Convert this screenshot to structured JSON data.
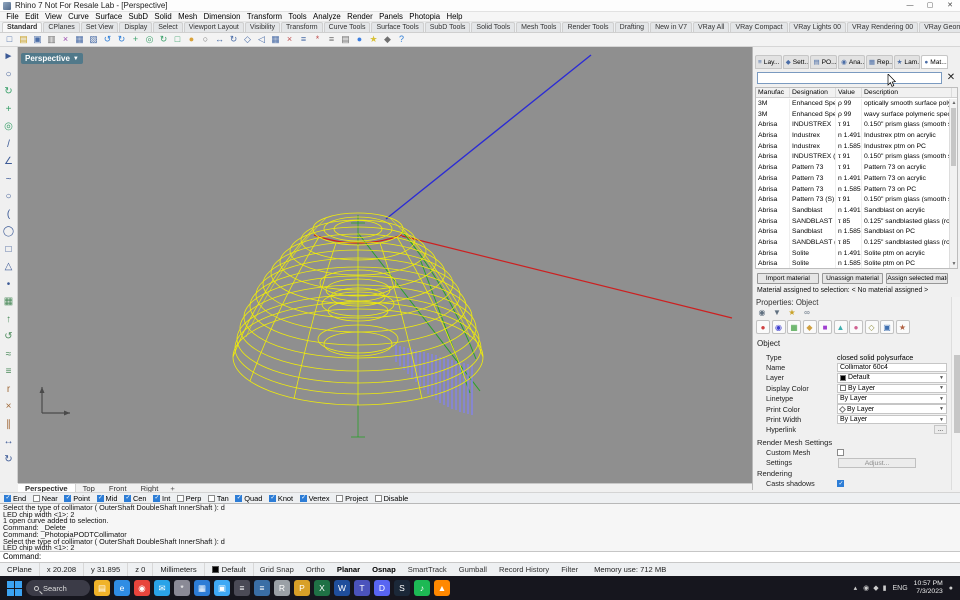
{
  "window": {
    "title": "Rhino 7 Not For Resale Lab - [Perspective]",
    "minimize": "—",
    "maximize": "▢",
    "close": "✕"
  },
  "menu": [
    "File",
    "Edit",
    "View",
    "Curve",
    "Surface",
    "SubD",
    "Solid",
    "Mesh",
    "Dimension",
    "Transform",
    "Tools",
    "Analyze",
    "Render",
    "Panels",
    "Photopia",
    "Help"
  ],
  "toolbar_tabs": [
    "Standard",
    "CPlanes",
    "Set View",
    "Display",
    "Select",
    "Viewport Layout",
    "Visibility",
    "Transform",
    "Curve Tools",
    "Surface Tools",
    "SubD Tools",
    "Solid Tools",
    "Mesh Tools",
    "Render Tools",
    "Drafting",
    "New in V7",
    "VRay All",
    "VRay Compact",
    "VRay Lights 00",
    "VRay Rendering 00",
    "VRay Geometry"
  ],
  "toolbar_icons": [
    {
      "name": "new-file-icon",
      "glyph": "□",
      "color": "#4a6da7"
    },
    {
      "name": "open-file-icon",
      "glyph": "▤",
      "color": "#c9a227"
    },
    {
      "name": "save-icon",
      "glyph": "▣",
      "color": "#4a6da7"
    },
    {
      "name": "print-icon",
      "glyph": "▥",
      "color": "#707070"
    },
    {
      "name": "cut-icon",
      "glyph": "×",
      "color": "#9a4aae"
    },
    {
      "name": "copy-icon",
      "glyph": "▦",
      "color": "#4a6da7"
    },
    {
      "name": "paste-icon",
      "glyph": "▧",
      "color": "#4a6da7"
    },
    {
      "name": "undo-icon",
      "glyph": "↺",
      "color": "#2d7dd6"
    },
    {
      "name": "redo-icon",
      "glyph": "↻",
      "color": "#2d7dd6"
    },
    {
      "name": "pan-view-icon",
      "glyph": "+",
      "color": "#3aa06a"
    },
    {
      "name": "zoom-icon",
      "glyph": "◎",
      "color": "#3aa06a"
    },
    {
      "name": "rotate-view-icon",
      "glyph": "↻",
      "color": "#3aa06a"
    },
    {
      "name": "zoom-extents-icon",
      "glyph": "□",
      "color": "#3aa06a"
    },
    {
      "name": "shaded-view-icon",
      "glyph": "●",
      "color": "#d9a23a"
    },
    {
      "name": "wireframe-view-icon",
      "glyph": "○",
      "color": "#707070"
    },
    {
      "name": "move-icon",
      "glyph": "↔",
      "color": "#4a6da7"
    },
    {
      "name": "rotate-icon",
      "glyph": "↻",
      "color": "#4a6da7"
    },
    {
      "name": "scale-icon",
      "glyph": "◇",
      "color": "#4a6da7"
    },
    {
      "name": "mirror-icon",
      "glyph": "◁",
      "color": "#4a6da7"
    },
    {
      "name": "array-icon",
      "glyph": "▦",
      "color": "#4a6da7"
    },
    {
      "name": "trim-icon",
      "glyph": "×",
      "color": "#c05050"
    },
    {
      "name": "join-icon",
      "glyph": "≡",
      "color": "#4a6da7"
    },
    {
      "name": "explode-icon",
      "glyph": "*",
      "color": "#c05050"
    },
    {
      "name": "layers-icon",
      "glyph": "≡",
      "color": "#707070"
    },
    {
      "name": "properties-icon",
      "glyph": "▤",
      "color": "#707070"
    },
    {
      "name": "render-icon",
      "glyph": "●",
      "color": "#3a7de0"
    },
    {
      "name": "lights-icon",
      "glyph": "★",
      "color": "#d9c23a"
    },
    {
      "name": "options-icon",
      "glyph": "◆",
      "color": "#707070"
    },
    {
      "name": "help-icon",
      "glyph": "?",
      "color": "#2d7dd6"
    }
  ],
  "left_toolbar": [
    {
      "name": "select-pointer-icon",
      "glyph": "►",
      "color": "#3c5a96"
    },
    {
      "name": "lasso-select-icon",
      "glyph": "○",
      "color": "#3c5a96"
    },
    {
      "name": "view-rotate-icon",
      "glyph": "↻",
      "color": "#3aa06a"
    },
    {
      "name": "pan-icon",
      "glyph": "+",
      "color": "#3aa06a"
    },
    {
      "name": "zoom-window-icon",
      "glyph": "◎",
      "color": "#3aa06a"
    },
    {
      "name": "line-tool-icon",
      "glyph": "/",
      "color": "#3c5a96"
    },
    {
      "name": "polyline-tool-icon",
      "glyph": "∠",
      "color": "#3c5a96"
    },
    {
      "name": "curve-tool-icon",
      "glyph": "~",
      "color": "#3c5a96"
    },
    {
      "name": "circle-tool-icon",
      "glyph": "○",
      "color": "#3c5a96"
    },
    {
      "name": "arc-tool-icon",
      "glyph": "(",
      "color": "#3c5a96"
    },
    {
      "name": "ellipse-tool-icon",
      "glyph": "◯",
      "color": "#3c5a96"
    },
    {
      "name": "rectangle-tool-icon",
      "glyph": "□",
      "color": "#3c5a96"
    },
    {
      "name": "polygon-tool-icon",
      "glyph": "△",
      "color": "#3c5a96"
    },
    {
      "name": "point-tool-icon",
      "glyph": "•",
      "color": "#3c5a96"
    },
    {
      "name": "surface-tool-icon",
      "glyph": "▦",
      "color": "#4a8a5a"
    },
    {
      "name": "extrude-tool-icon",
      "glyph": "↑",
      "color": "#4a8a5a"
    },
    {
      "name": "revolve-tool-icon",
      "glyph": "↺",
      "color": "#4a8a5a"
    },
    {
      "name": "sweep-tool-icon",
      "glyph": "≈",
      "color": "#4a8a5a"
    },
    {
      "name": "loft-tool-icon",
      "glyph": "≡",
      "color": "#4a8a5a"
    },
    {
      "name": "fillet-tool-icon",
      "glyph": "r",
      "color": "#a06a3a"
    },
    {
      "name": "trim-tool-icon",
      "glyph": "×",
      "color": "#a06a3a"
    },
    {
      "name": "split-tool-icon",
      "glyph": "∥",
      "color": "#a06a3a"
    },
    {
      "name": "move-tool-icon",
      "glyph": "↔",
      "color": "#3c5a96"
    },
    {
      "name": "rotate-tool-icon",
      "glyph": "↻",
      "color": "#3c5a96"
    }
  ],
  "viewport": {
    "label": "Perspective",
    "dropdown_glyph": "▼",
    "colors": {
      "wire_yellow": "#f0ec0a",
      "line_blue": "#2b2bd5",
      "line_red": "#cc2020",
      "line_green": "#27a327",
      "hatch_purple": "#8585e0",
      "background": "#8f8f8f"
    }
  },
  "right_panel": {
    "tabs": [
      {
        "label": "Lay...",
        "icon": "≡",
        "icon_name": "layers-tab-icon"
      },
      {
        "label": "Sett...",
        "icon": "◆",
        "icon_name": "settings-tab-icon"
      },
      {
        "label": "PO...",
        "icon": "▤",
        "icon_name": "po-tab-icon"
      },
      {
        "label": "Ana...",
        "icon": "◉",
        "icon_name": "analyze-tab-icon"
      },
      {
        "label": "Rep...",
        "icon": "▦",
        "icon_name": "report-tab-icon"
      },
      {
        "label": "Lam...",
        "icon": "★",
        "icon_name": "lamp-tab-icon"
      },
      {
        "label": "Mat...",
        "icon": "●",
        "icon_name": "materials-tab-icon",
        "active": true
      }
    ],
    "search_value": "",
    "table": {
      "headers": [
        "Manufac",
        "Designation",
        "Value",
        "Description"
      ],
      "rows": [
        [
          "3M",
          "Enhanced Spec",
          "ρ 99",
          "optically smooth surface polymeri..."
        ],
        [
          "3M",
          "Enhanced Spec",
          "ρ 99",
          "wavy surface polymeric specular ..."
        ],
        [
          "Abrisa",
          "INDUSTREX",
          "τ 91",
          "0.150\" prism glass (smooth side t..."
        ],
        [
          "Abrisa",
          "Industrex",
          "n 1.491",
          "Industrex ptm on acrylic"
        ],
        [
          "Abrisa",
          "Industrex",
          "n 1.585",
          "Industrex ptm on PC"
        ],
        [
          "Abrisa",
          "INDUSTREX (S)",
          "τ 91",
          "0.150\" prism glass (smooth side t..."
        ],
        [
          "Abrisa",
          "Pattern 73",
          "τ 91",
          "Pattern 73 on acrylic"
        ],
        [
          "Abrisa",
          "Pattern 73",
          "n 1.491",
          "Pattern 73 on acrylic"
        ],
        [
          "Abrisa",
          "Pattern 73",
          "n 1.585",
          "Pattern 73 on PC"
        ],
        [
          "Abrisa",
          "Pattern 73 (S)",
          "τ 91",
          "0.150\" prism glass (smooth side t..."
        ],
        [
          "Abrisa",
          "Sandblast",
          "n 1.491",
          "Sandblast on acrylic"
        ],
        [
          "Abrisa",
          "SANDBLAST",
          "τ 85",
          "0.125\" sandblasted glass (rough si..."
        ],
        [
          "Abrisa",
          "Sandblast",
          "n 1.585",
          "Sandblast on PC"
        ],
        [
          "Abrisa",
          "SANDBLAST (S)",
          "τ 85",
          "0.125\" sandblasted glass (rough si..."
        ],
        [
          "Abrisa",
          "Solite",
          "n 1.491",
          "Solite ptm on acrylic"
        ],
        [
          "Abrisa",
          "Solite",
          "n 1.585",
          "Solite ptm on PC"
        ]
      ]
    },
    "buttons": [
      "Import material",
      "Unassign material",
      "Assign selected material"
    ],
    "assign_text": "Material assigned to selection: < No material assigned >"
  },
  "properties": {
    "header": "Properties: Object",
    "toolbar_icons": [
      {
        "name": "viewport-props-icon",
        "glyph": "◉",
        "color": "#607080"
      },
      {
        "name": "filter-props-icon",
        "glyph": "▼",
        "color": "#607080"
      },
      {
        "name": "light-props-icon",
        "glyph": "★",
        "color": "#c9a227"
      },
      {
        "name": "link-props-icon",
        "glyph": "∞",
        "color": "#607080"
      }
    ],
    "tab_icons": [
      {
        "name": "properties-tab-object-icon",
        "glyph": "●",
        "color": "#d04040"
      },
      {
        "name": "properties-tab-material-icon",
        "glyph": "◉",
        "color": "#4040d0"
      },
      {
        "name": "properties-tab-texture-icon",
        "glyph": "▦",
        "color": "#40a040"
      },
      {
        "name": "properties-tab-dimension-icon",
        "glyph": "◆",
        "color": "#d0a040"
      },
      {
        "name": "properties-tab-mapping-icon",
        "glyph": "■",
        "color": "#a040d0"
      },
      {
        "name": "properties-tab-photopia-icon",
        "glyph": "▲",
        "color": "#40b0b0"
      },
      {
        "name": "properties-tab-render-icon",
        "glyph": "●",
        "color": "#d06090"
      },
      {
        "name": "properties-tab-mesh-icon",
        "glyph": "◇",
        "color": "#909040"
      },
      {
        "name": "properties-tab-display-icon",
        "glyph": "▣",
        "color": "#4070b0"
      },
      {
        "name": "properties-tab-info-icon",
        "glyph": "★",
        "color": "#b06040"
      }
    ],
    "section": "Object",
    "fields": [
      {
        "label": "Type",
        "value": "closed solid polysurface",
        "control": "plain"
      },
      {
        "label": "Name",
        "value": "Collimator 60c4",
        "control": "input"
      },
      {
        "label": "Layer",
        "value": "Default",
        "control": "dropdown",
        "swatch": "#000000"
      },
      {
        "label": "Display Color",
        "value": "By Layer",
        "control": "dropdown",
        "swatch": "#ffffff"
      },
      {
        "label": "Linetype",
        "value": "By Layer",
        "control": "dropdown"
      },
      {
        "label": "Print Color",
        "value": "By Layer",
        "control": "dropdown",
        "swatch_shape": "diamond"
      },
      {
        "label": "Print Width",
        "value": "By Layer",
        "control": "dropdown"
      },
      {
        "label": "Hyperlink",
        "value": "",
        "control": "ellipsis"
      }
    ],
    "render_mesh_title": "Render Mesh Settings",
    "custom_mesh_label": "Custom Mesh",
    "custom_mesh_checked": false,
    "settings_label": "Settings",
    "settings_button": "Adjust...",
    "rendering_title": "Rendering",
    "casts_shadows_label": "Casts shadows",
    "casts_shadows_checked": true
  },
  "viewport_tabs": {
    "tabs": [
      "Perspective",
      "Top",
      "Front",
      "Right"
    ],
    "active_index": 0,
    "new_tab_glyph": "+"
  },
  "osnap": {
    "items": [
      {
        "label": "End",
        "checked": true
      },
      {
        "label": "Near",
        "checked": false
      },
      {
        "label": "Point",
        "checked": true
      },
      {
        "label": "Mid",
        "checked": true
      },
      {
        "label": "Cen",
        "checked": true
      },
      {
        "label": "Int",
        "checked": true
      },
      {
        "label": "Perp",
        "checked": false
      },
      {
        "label": "Tan",
        "checked": false
      },
      {
        "label": "Quad",
        "checked": true
      },
      {
        "label": "Knot",
        "checked": true
      },
      {
        "label": "Vertex",
        "checked": true
      },
      {
        "label": "Project",
        "checked": false
      },
      {
        "label": "Disable",
        "checked": false
      }
    ]
  },
  "command": {
    "history": [
      "Select the type of collimator ( OuterShaft  DoubleShaft  InnerShaft ): d",
      "LED chip width <1>: 2",
      "1 open curve added to selection.",
      "Command: _Delete",
      "Command: _PhotopiaPODTCollimator",
      "Select the type of collimator ( OuterShaft  DoubleShaft  InnerShaft ): d",
      "LED chip width <1>: 2"
    ],
    "prompt": "Command:"
  },
  "status": {
    "cplane": "CPlane",
    "x": "x 20.208",
    "y": "y 31.895",
    "z": "z 0",
    "units": "Millimeters",
    "layer": "Default",
    "layer_color": "#000000",
    "toggles": [
      {
        "label": "Grid Snap",
        "active": false
      },
      {
        "label": "Ortho",
        "active": false
      },
      {
        "label": "Planar",
        "active": true
      },
      {
        "label": "Osnap",
        "active": true
      },
      {
        "label": "SmartTrack",
        "active": false
      },
      {
        "label": "Gumball",
        "active": false
      },
      {
        "label": "Record History",
        "active": false
      },
      {
        "label": "Filter",
        "active": false
      }
    ],
    "memory": "Memory use: 712 MB"
  },
  "taskbar": {
    "search_label": "Search",
    "apps": [
      {
        "name": "file-explorer-icon",
        "glyph": "▤",
        "color": "#f0b32a"
      },
      {
        "name": "edge-browser-icon",
        "glyph": "e",
        "color": "#2f8de4"
      },
      {
        "name": "chrome-browser-icon",
        "glyph": "◉",
        "color": "#e8453c"
      },
      {
        "name": "mail-icon",
        "glyph": "✉",
        "color": "#2aa3e8"
      },
      {
        "name": "settings-app-icon",
        "glyph": "*",
        "color": "#8a8a96"
      },
      {
        "name": "store-icon",
        "glyph": "▦",
        "color": "#2d7dd6"
      },
      {
        "name": "photos-icon",
        "glyph": "▣",
        "color": "#3fa9f5"
      },
      {
        "name": "calculator-icon",
        "glyph": "≡",
        "color": "#4a4a56"
      },
      {
        "name": "notepad-icon",
        "glyph": "≡",
        "color": "#3a6ea5"
      },
      {
        "name": "rhino-app-icon",
        "glyph": "R",
        "color": "#9aa0a6"
      },
      {
        "name": "photopia-app-icon",
        "glyph": "P",
        "color": "#d8a028"
      },
      {
        "name": "excel-icon",
        "glyph": "X",
        "color": "#1f7145"
      },
      {
        "name": "word-icon",
        "glyph": "W",
        "color": "#1f4e9c"
      },
      {
        "name": "teams-icon",
        "glyph": "T",
        "color": "#4b53bc"
      },
      {
        "name": "discord-icon",
        "glyph": "D",
        "color": "#5865f2"
      },
      {
        "name": "steam-icon",
        "glyph": "S",
        "color": "#1b2838"
      },
      {
        "name": "spotify-icon",
        "glyph": "♪",
        "color": "#1db954"
      },
      {
        "name": "media-player-icon",
        "glyph": "▲",
        "color": "#ff8800"
      }
    ],
    "tray": {
      "chevron": "▴",
      "icons": [
        {
          "name": "network-icon",
          "glyph": "◉"
        },
        {
          "name": "volume-icon",
          "glyph": "◆"
        },
        {
          "name": "battery-icon",
          "glyph": "▮"
        }
      ],
      "lang": "ENG",
      "time": "10:57 PM",
      "date": "7/3/2023",
      "notification_glyph": "●"
    }
  }
}
